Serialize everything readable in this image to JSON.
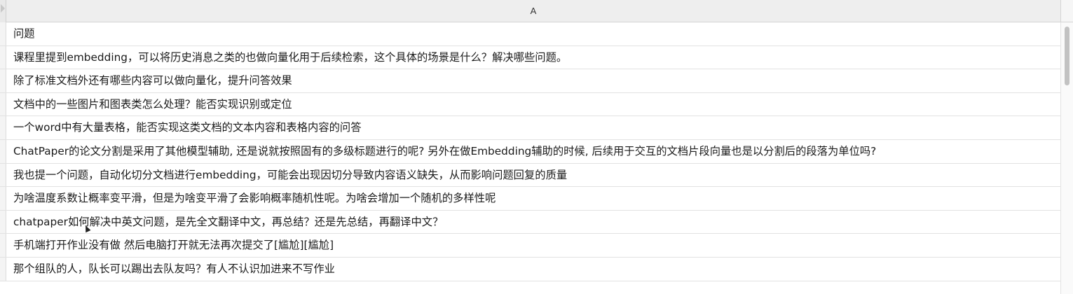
{
  "spreadsheet": {
    "column_header": "A",
    "rows": [
      "问题",
      "课程里提到embedding，可以将历史消息之类的也做向量化用于后续检索，这个具体的场景是什么？解决哪些问题。",
      " 除了标准文档外还有哪些内容可以做向量化，提升问答效果",
      "文档中的一些图片和图表类怎么处理？能否实现识别或定位",
      "一个word中有大量表格，能否实现这类文档的文本内容和表格内容的问答",
      " ChatPaper的论文分割是采用了其他模型辅助, 还是说就按照固有的多级标题进行的呢? 另外在做Embedding辅助的时候, 后续用于交互的文档片段向量也是以分割后的段落为单位吗?",
      "我也提一个问题，自动化切分文档进行embedding，可能会出现因切分导致内容语义缺失，从而影响问题回复的质量",
      "为啥温度系数让概率变平滑，但是为啥变平滑了会影响概率随机性呢。为啥会增加一个随机的多样性呢",
      "chatpaper如何解决中英文问题，是先全文翻译中文，再总结？还是先总结，再翻译中文？",
      "手机端打开作业没有做 然后电脑打开就无法再次提交了[尴尬][尴尬]",
      "那个组队的人，队长可以踢出去队友吗？有人不认识加进来不写作业"
    ]
  }
}
